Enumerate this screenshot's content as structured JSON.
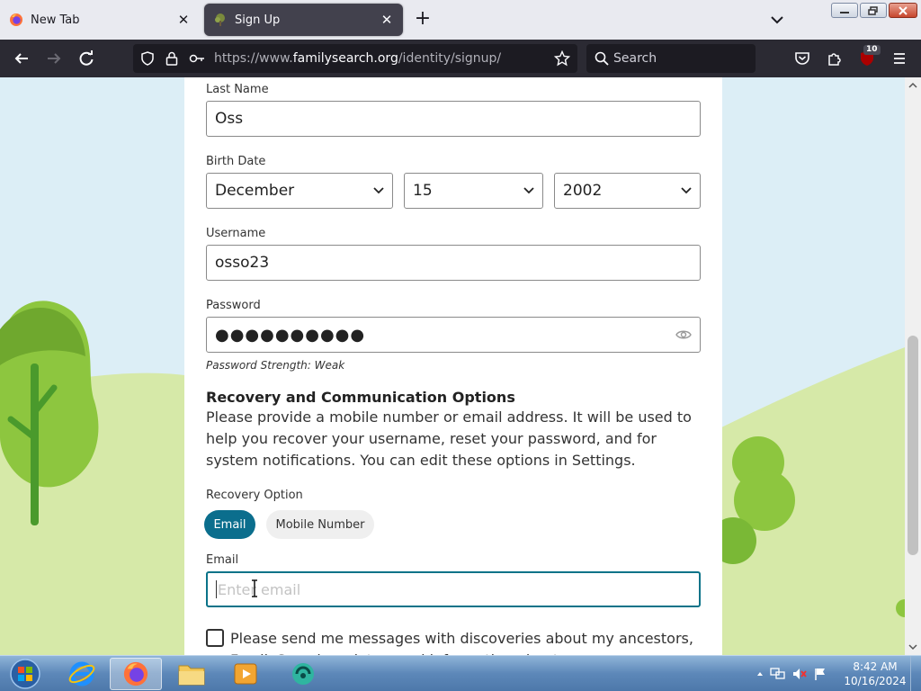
{
  "browser": {
    "tabs": [
      {
        "label": "New Tab",
        "active": false
      },
      {
        "label": "Sign Up",
        "active": true
      }
    ],
    "url_prefix": "https://www.",
    "url_host": "familysearch.org",
    "url_path": "/identity/signup/",
    "search_placeholder": "Search",
    "extension_badge": "10"
  },
  "form": {
    "last_name": {
      "label": "Last Name",
      "value": "Oss"
    },
    "birth_date": {
      "label": "Birth Date",
      "month": "December",
      "day": "15",
      "year": "2002"
    },
    "username": {
      "label": "Username",
      "value": "osso23"
    },
    "password": {
      "label": "Password",
      "masked_value": "●●●●●●●●●●",
      "strength": "Password Strength: Weak"
    },
    "recovery": {
      "title": "Recovery and Communication Options",
      "description": "Please provide a mobile number or email address. It will be used to help you recover your username, reset your password, and for system notifications. You can edit these options in Settings.",
      "option_label": "Recovery Option",
      "options": [
        "Email",
        "Mobile Number"
      ],
      "selected": "Email"
    },
    "email": {
      "label": "Email",
      "placeholder": "Enter email",
      "value": ""
    },
    "messages_checkbox": {
      "label": "Please send me messages with discoveries about my ancestors, FamilySearch updates, and information about",
      "checked": false
    }
  },
  "taskbar": {
    "time": "8:42 AM",
    "date": "10/16/2024"
  },
  "colors": {
    "accent": "#0b6e8d",
    "focus_border": "#0a7389",
    "browser_dark": "#2b2a33"
  }
}
